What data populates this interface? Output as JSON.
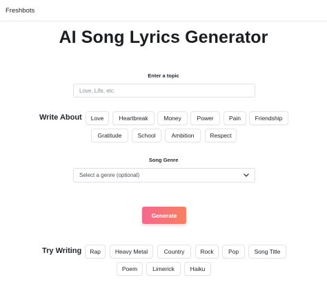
{
  "header": {
    "brand": "Freshbots"
  },
  "page": {
    "title": "AI Song Lyrics Generator"
  },
  "topic": {
    "label": "Enter a topic",
    "placeholder": "Love, Life, etc."
  },
  "write_about": {
    "heading": "Write About",
    "chips": [
      "Love",
      "Heartbreak",
      "Money",
      "Power",
      "Pain",
      "Friendship",
      "Gratitude",
      "School",
      "Ambition",
      "Respect"
    ]
  },
  "genre": {
    "label": "Song Genre",
    "selected": "Select a genre (optional)"
  },
  "generate": {
    "label": "Generate",
    "gradient": [
      "#f5678f",
      "#f8805f"
    ]
  },
  "try_writing": {
    "heading": "Try Writing",
    "chips": [
      "Rap",
      "Heavy Metal",
      "Country",
      "Rock",
      "Pop",
      "Song Title",
      "Poem",
      "Limerick",
      "Haiku"
    ]
  },
  "icons": {
    "select_chevron": "chevron-down-icon"
  }
}
